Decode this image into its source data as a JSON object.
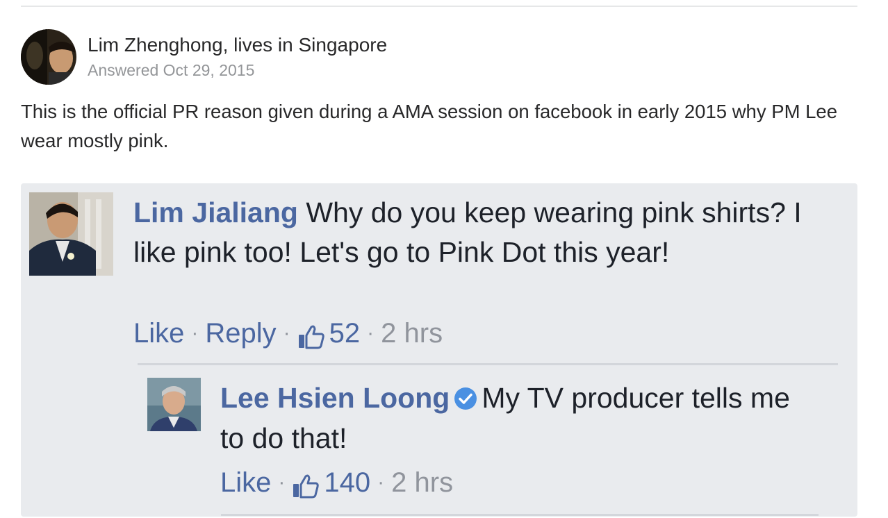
{
  "post": {
    "author_line": "Lim Zhenghong, lives in Singapore",
    "answered": "Answered Oct 29, 2015",
    "body": "This is the official PR reason given during a AMA session on facebook in early 2015 why PM Lee wear mostly pink."
  },
  "embed": {
    "comment": {
      "author": "Lim Jialiang",
      "text": "Why do you keep wearing pink shirts? I like pink too! Let's go to Pink Dot this year!",
      "like_label": "Like",
      "reply_label": "Reply",
      "like_count": "52",
      "time": "2 hrs"
    },
    "reply": {
      "author": "Lee Hsien Loong",
      "text": "My TV producer tells me to do that!",
      "like_label": "Like",
      "like_count": "140",
      "time": "2 hrs"
    },
    "separator": "·"
  },
  "icons": {
    "thumb": "thumbs-up-icon",
    "verified": "verified-badge-icon"
  },
  "colors": {
    "link_blue": "#4b67a1",
    "verified_blue": "#4a90e2",
    "meta_gray": "#90949c",
    "embed_bg": "#e9ebee"
  }
}
